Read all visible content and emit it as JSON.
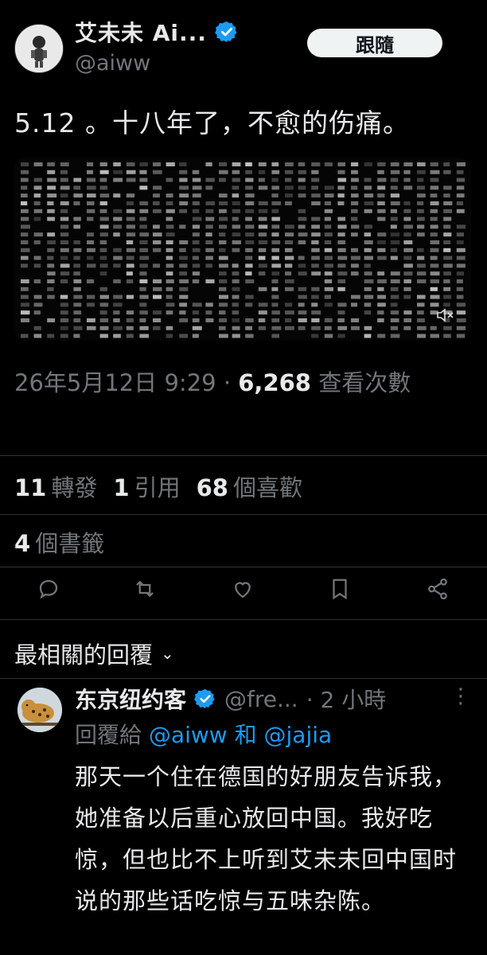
{
  "author": {
    "name": "艾未未  Ai...",
    "handle": "@aiww",
    "follow_label": "跟隨"
  },
  "tweet": {
    "text": "5.12 。十八年了，不愈的伤痛。",
    "date": "26年5月12日 9:29 · ",
    "views_count": "6,268",
    "views_label": " 查看次數"
  },
  "stats": {
    "retweets_count": "11",
    "retweets_label": "轉發",
    "quotes_count": "1",
    "quotes_label": "引用",
    "likes_count": "68",
    "likes_label": "個喜歡",
    "bookmarks_count": "4",
    "bookmarks_label": "個書籤"
  },
  "actions": [
    "reply-icon",
    "retweet-icon",
    "like-icon",
    "bookmark-icon",
    "share-icon"
  ],
  "sort": {
    "label": "最相關的回覆"
  },
  "reply": {
    "name": "东京纽约客",
    "handle": "@fre...",
    "time": "· 2 小時",
    "more": "⋮",
    "reply_to_prefix": "回覆給",
    "mention_1": "@aiww",
    "and": "和",
    "mention_2": "@jajia",
    "body": "那天一个住在德国的好朋友告诉我，她准备以后重心放回中国。我好吃惊，但也比不上听到艾未未回中国时说的那些话吃惊与五味杂陈。"
  },
  "colors": {
    "background": "#000000",
    "text": "#e7e9ea",
    "muted": "#71767b",
    "accent": "#1d9bf0"
  }
}
